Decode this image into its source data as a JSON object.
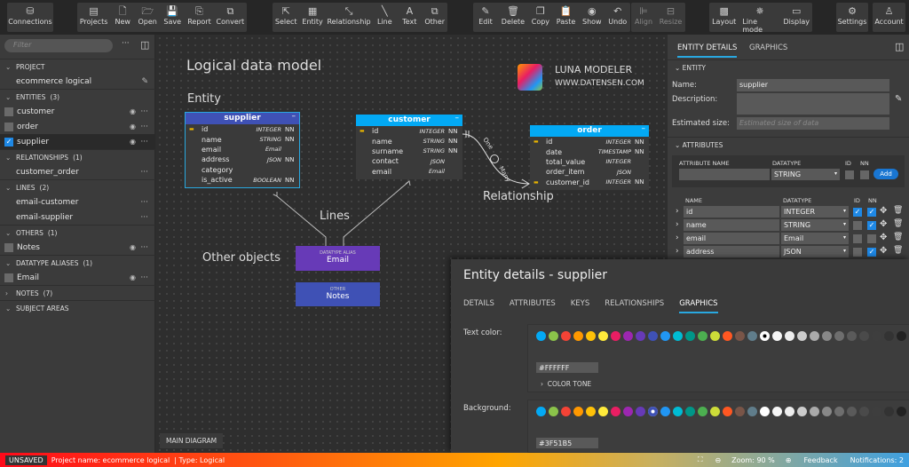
{
  "toolbar": {
    "groups": [
      [
        {
          "label": "Connections",
          "icon": "database-icon",
          "g": "⛁"
        }
      ],
      [
        {
          "label": "Projects",
          "icon": "projects-icon",
          "g": "▤"
        },
        {
          "label": "New",
          "icon": "new-file-icon",
          "g": "🗋"
        },
        {
          "label": "Open",
          "icon": "folder-open-icon",
          "g": "🗁"
        },
        {
          "label": "Save",
          "icon": "save-icon",
          "g": "💾"
        },
        {
          "label": "Report",
          "icon": "report-icon",
          "g": "⎘"
        },
        {
          "label": "Convert",
          "icon": "convert-icon",
          "g": "⧉"
        }
      ],
      [
        {
          "label": "Select",
          "icon": "cursor-icon",
          "g": "⇱"
        },
        {
          "label": "Entity",
          "icon": "entity-icon",
          "g": "▦"
        },
        {
          "label": "Relationship",
          "icon": "relationship-icon",
          "g": "⤡"
        },
        {
          "label": "Line",
          "icon": "line-icon",
          "g": "╲"
        },
        {
          "label": "Text",
          "icon": "text-icon",
          "g": "A"
        },
        {
          "label": "Other",
          "icon": "other-icon",
          "g": "⧉"
        }
      ],
      [
        {
          "label": "Edit",
          "icon": "pencil-icon",
          "g": "✎"
        },
        {
          "label": "Delete",
          "icon": "trash-icon",
          "g": "🗑"
        },
        {
          "label": "Copy",
          "icon": "copy-icon",
          "g": "❐"
        },
        {
          "label": "Paste",
          "icon": "paste-icon",
          "g": "📋"
        },
        {
          "label": "Show",
          "icon": "eye-icon",
          "g": "◉"
        },
        {
          "label": "Undo",
          "icon": "undo-icon",
          "g": "↶"
        }
      ],
      [
        {
          "label": "Align",
          "icon": "align-icon",
          "g": "⊫",
          "dis": true
        },
        {
          "label": "Resize",
          "icon": "resize-icon",
          "g": "⊟",
          "dis": true
        }
      ],
      [
        {
          "label": "Layout",
          "icon": "layout-icon",
          "g": "▩"
        },
        {
          "label": "Line mode",
          "icon": "line-mode-icon",
          "g": "✵"
        },
        {
          "label": "Display",
          "icon": "display-icon",
          "g": "▭"
        }
      ],
      [
        {
          "label": "Settings",
          "icon": "gear-icon",
          "g": "⚙"
        }
      ],
      [
        {
          "label": "Account",
          "icon": "user-icon",
          "g": "♙"
        }
      ]
    ]
  },
  "sidebar": {
    "filter_placeholder": "Filter",
    "sections": [
      {
        "title": "PROJECT",
        "count": "",
        "open": true,
        "items": [
          {
            "label": "ecommerce logical",
            "edit": true
          }
        ]
      },
      {
        "title": "ENTITIES",
        "count": "(3)",
        "open": true,
        "items": [
          {
            "label": "customer",
            "cb": true,
            "eye": true
          },
          {
            "label": "order",
            "cb": true,
            "eye": true
          },
          {
            "label": "supplier",
            "cb": true,
            "checked": true,
            "eye": true,
            "selected": true
          }
        ]
      },
      {
        "title": "RELATIONSHIPS",
        "count": "(1)",
        "open": true,
        "items": [
          {
            "label": "customer_order"
          }
        ]
      },
      {
        "title": "LINES",
        "count": "(2)",
        "open": true,
        "items": [
          {
            "label": "email-customer"
          },
          {
            "label": "email-supplier"
          }
        ]
      },
      {
        "title": "OTHERS",
        "count": "(1)",
        "open": true,
        "items": [
          {
            "label": "Notes",
            "cb": true,
            "eye": true
          }
        ]
      },
      {
        "title": "DATATYPE ALIASES",
        "count": "(1)",
        "open": true,
        "items": [
          {
            "label": "Email",
            "cb": true,
            "eye": true
          }
        ]
      },
      {
        "title": "NOTES",
        "count": "(7)",
        "open": false,
        "items": []
      },
      {
        "title": "SUBJECT AREAS",
        "count": "",
        "open": true,
        "items": []
      }
    ]
  },
  "canvas": {
    "title": "Logical data model",
    "label_entity": "Entity",
    "label_lines": "Lines",
    "label_other": "Other objects",
    "label_relationship": "Relationship",
    "brand": "LUNA MODELER",
    "site": "WWW.DATENSEN.COM",
    "rel_one": "One",
    "rel_many": "Many",
    "entities": [
      {
        "name": "supplier",
        "color": "#3f51b5",
        "rows": [
          [
            "pk",
            "id",
            "INTEGER",
            "NN"
          ],
          [
            "",
            "name",
            "STRING",
            "NN"
          ],
          [
            "",
            "email",
            "Email",
            ""
          ],
          [
            "",
            "address",
            "JSON",
            "NN"
          ],
          [
            "",
            "category",
            "",
            ""
          ],
          [
            "",
            "is_active",
            "BOOLEAN",
            "NN"
          ]
        ]
      },
      {
        "name": "customer",
        "color": "#03a9f4",
        "rows": [
          [
            "pk",
            "id",
            "INTEGER",
            "NN"
          ],
          [
            "",
            "name",
            "STRING",
            "NN"
          ],
          [
            "",
            "surname",
            "STRING",
            "NN"
          ],
          [
            "",
            "contact",
            "JSON",
            ""
          ],
          [
            "",
            "email",
            "Email",
            ""
          ]
        ]
      },
      {
        "name": "order",
        "color": "#03a9f4",
        "rows": [
          [
            "pk",
            "id",
            "INTEGER",
            "NN"
          ],
          [
            "",
            "date",
            "TIMESTAMP",
            "NN"
          ],
          [
            "",
            "total_value",
            "INTEGER",
            ""
          ],
          [
            "",
            "order_item",
            "JSON",
            ""
          ],
          [
            "fk",
            "customer_id",
            "INTEGER",
            "NN"
          ]
        ]
      }
    ],
    "alias": {
      "kind": "DATATYPE ALIAS",
      "name": "Email",
      "color": "#673ab7"
    },
    "other": {
      "kind": "OTHER",
      "name": "Notes",
      "color": "#3f51b5"
    },
    "tab": "MAIN DIAGRAM"
  },
  "right": {
    "tabs": [
      "ENTITY DETAILS",
      "GRAPHICS"
    ],
    "entity_section": "ENTITY",
    "name_label": "Name:",
    "name_value": "supplier",
    "desc_label": "Description:",
    "size_label": "Estimated size:",
    "size_placeholder": "Estimated size of data",
    "attr_section": "ATTRIBUTES",
    "new_attr": {
      "name_h": "ATTRIBUTE NAME",
      "type_h": "DATATYPE",
      "id_h": "ID",
      "nn_h": "NN",
      "type_value": "STRING",
      "add": "Add"
    },
    "cols": {
      "name": "NAME",
      "type": "DATATYPE",
      "id": "ID",
      "nn": "NN"
    },
    "attrs": [
      {
        "name": "id",
        "type": "INTEGER",
        "id": true,
        "nn": true
      },
      {
        "name": "name",
        "type": "STRING",
        "id": false,
        "nn": true
      },
      {
        "name": "email",
        "type": "Email",
        "id": false,
        "nn": false
      },
      {
        "name": "address",
        "type": "JSON",
        "id": false,
        "nn": true
      }
    ]
  },
  "modal": {
    "title": "Entity details - supplier",
    "tabs": [
      "DETAILS",
      "ATTRIBUTES",
      "KEYS",
      "RELATIONSHIPS",
      "GRAPHICS"
    ],
    "active_tab": "GRAPHICS",
    "text_color_label": "Text color:",
    "text_color": "#FFFFFF",
    "color_tone": "COLOR TONE",
    "bg_label": "Background:",
    "bg_color": "#3F51B5",
    "palette": [
      "#03a9f4",
      "#8bc34a",
      "#f44336",
      "#ff9800",
      "#ffc107",
      "#ffeb3b",
      "#e91e63",
      "#9c27b0",
      "#673ab7",
      "#3f51b5",
      "#2196f3",
      "#00bcd4",
      "#009688",
      "#4caf50",
      "#cddc39",
      "#ff5722",
      "#795548",
      "#607d8b",
      "#ffffff",
      "#f5f5f5",
      "#eeeeee",
      "#cccccc",
      "#aaaaaa",
      "#888888",
      "#6e6e6e",
      "#5a5a5a",
      "#4a4a4a",
      "#3e3e3e",
      "#333333",
      "#222222"
    ]
  },
  "status": {
    "unsaved": "UNSAVED",
    "project": "Project name: ecommerce logical",
    "type": "| Type: Logical",
    "zoom": "Zoom: 90 %",
    "feedback": "Feedback",
    "notifications": "Notifications: 2"
  }
}
